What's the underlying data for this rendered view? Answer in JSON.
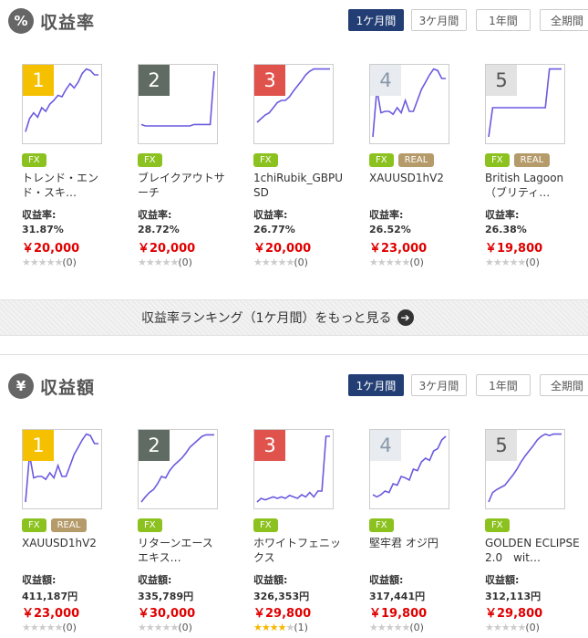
{
  "rate_section": {
    "icon": "%",
    "title": "収益率",
    "tabs": [
      "1ケ月間",
      "3ケ月間",
      "1年間",
      "全期間"
    ],
    "active_tab": 0,
    "metric_label": "収益率:",
    "cards": [
      {
        "rank": "1",
        "badges": [
          "FX"
        ],
        "name": "トレンド・エンド・スキ…",
        "metric": "31.87%",
        "price": "￥20,000",
        "stars": 0,
        "reviews": "(0)",
        "chart": [
          0.12,
          0.3,
          0.38,
          0.32,
          0.45,
          0.4,
          0.5,
          0.55,
          0.62,
          0.6,
          0.7,
          0.78,
          0.72,
          0.8,
          0.92,
          0.98,
          0.96,
          0.9,
          0.9
        ]
      },
      {
        "rank": "2",
        "badges": [
          "FX"
        ],
        "name": "ブレイクアウトサーチ",
        "metric": "28.72%",
        "price": "￥20,000",
        "stars": 0,
        "reviews": "(0)",
        "chart": [
          0.22,
          0.2,
          0.2,
          0.2,
          0.2,
          0.2,
          0.2,
          0.2,
          0.2,
          0.2,
          0.2,
          0.2,
          0.2,
          0.22,
          0.22,
          0.22,
          0.22,
          0.22,
          0.95
        ]
      },
      {
        "rank": "3",
        "badges": [
          "FX"
        ],
        "name": "1chiRubik_GBPUSD",
        "metric": "26.77%",
        "price": "￥20,000",
        "stars": 0,
        "reviews": "(0)",
        "chart": [
          0.25,
          0.3,
          0.35,
          0.38,
          0.45,
          0.52,
          0.55,
          0.55,
          0.6,
          0.68,
          0.75,
          0.82,
          0.9,
          0.95,
          0.98,
          0.98,
          0.98,
          0.98,
          0.98
        ]
      },
      {
        "rank": "4",
        "badges": [
          "FX",
          "REAL"
        ],
        "name": "XAUUSD1hV2",
        "metric": "26.52%",
        "price": "￥23,000",
        "stars": 0,
        "reviews": "(0)",
        "chart": [
          0.05,
          0.7,
          0.38,
          0.4,
          0.4,
          0.36,
          0.45,
          0.38,
          0.55,
          0.4,
          0.4,
          0.55,
          0.7,
          0.8,
          0.9,
          0.98,
          0.96,
          0.85,
          0.85
        ]
      },
      {
        "rank": "5",
        "badges": [
          "FX",
          "REAL"
        ],
        "name": "British Lagoon（ブリティ…",
        "metric": "26.38%",
        "price": "￥19,800",
        "stars": 0,
        "reviews": "(0)",
        "chart": [
          0.05,
          0.45,
          0.45,
          0.45,
          0.45,
          0.45,
          0.45,
          0.45,
          0.45,
          0.45,
          0.45,
          0.45,
          0.45,
          0.45,
          0.45,
          0.98,
          0.98,
          0.98,
          0.98
        ]
      }
    ],
    "more_label": "収益率ランキング（1ケ月間）をもっと見る"
  },
  "amount_section": {
    "icon": "¥",
    "title": "収益額",
    "tabs": [
      "1ケ月間",
      "3ケ月間",
      "1年間",
      "全期間"
    ],
    "active_tab": 0,
    "metric_label": "収益額:",
    "cards": [
      {
        "rank": "1",
        "badges": [
          "FX",
          "REAL"
        ],
        "name": "XAUUSD1hV2",
        "metric": "411,187円",
        "price": "￥23,000",
        "stars": 0,
        "reviews": "(0)",
        "chart": [
          0.05,
          0.7,
          0.38,
          0.4,
          0.4,
          0.36,
          0.45,
          0.38,
          0.55,
          0.4,
          0.4,
          0.55,
          0.7,
          0.8,
          0.9,
          0.98,
          0.96,
          0.85,
          0.85
        ]
      },
      {
        "rank": "2",
        "badges": [
          "FX"
        ],
        "name": "リターンエース　エキス…",
        "metric": "335,789円",
        "price": "￥30,000",
        "stars": 0,
        "reviews": "(0)",
        "chart": [
          0.05,
          0.12,
          0.18,
          0.22,
          0.3,
          0.4,
          0.38,
          0.48,
          0.55,
          0.6,
          0.65,
          0.72,
          0.8,
          0.85,
          0.9,
          0.95,
          0.97,
          0.97,
          0.97
        ]
      },
      {
        "rank": "3",
        "badges": [
          "FX"
        ],
        "name": "ホワイトフェニックス",
        "metric": "326,353円",
        "price": "￥29,800",
        "stars": 4,
        "reviews": "(1)",
        "chart": [
          0.05,
          0.1,
          0.08,
          0.1,
          0.12,
          0.1,
          0.12,
          0.1,
          0.14,
          0.12,
          0.1,
          0.15,
          0.12,
          0.18,
          0.12,
          0.2,
          0.2,
          0.95,
          0.95
        ]
      },
      {
        "rank": "4",
        "badges": [
          "FX"
        ],
        "name": "堅牢君 オジ円",
        "metric": "317,441円",
        "price": "￥19,800",
        "stars": 0,
        "reviews": "(0)",
        "chart": [
          0.15,
          0.12,
          0.15,
          0.2,
          0.18,
          0.3,
          0.28,
          0.4,
          0.38,
          0.35,
          0.5,
          0.48,
          0.6,
          0.65,
          0.62,
          0.75,
          0.78,
          0.9,
          0.95
        ]
      },
      {
        "rank": "5",
        "badges": [
          "FX"
        ],
        "name": "GOLDEN ECLIPSE2.0　wit…",
        "metric": "312,113円",
        "price": "￥29,800",
        "stars": 0,
        "reviews": "(0)",
        "chart": [
          0.05,
          0.18,
          0.22,
          0.25,
          0.28,
          0.35,
          0.42,
          0.5,
          0.6,
          0.68,
          0.75,
          0.82,
          0.9,
          0.95,
          0.98,
          0.96,
          0.98,
          0.98,
          0.98
        ]
      }
    ]
  }
}
